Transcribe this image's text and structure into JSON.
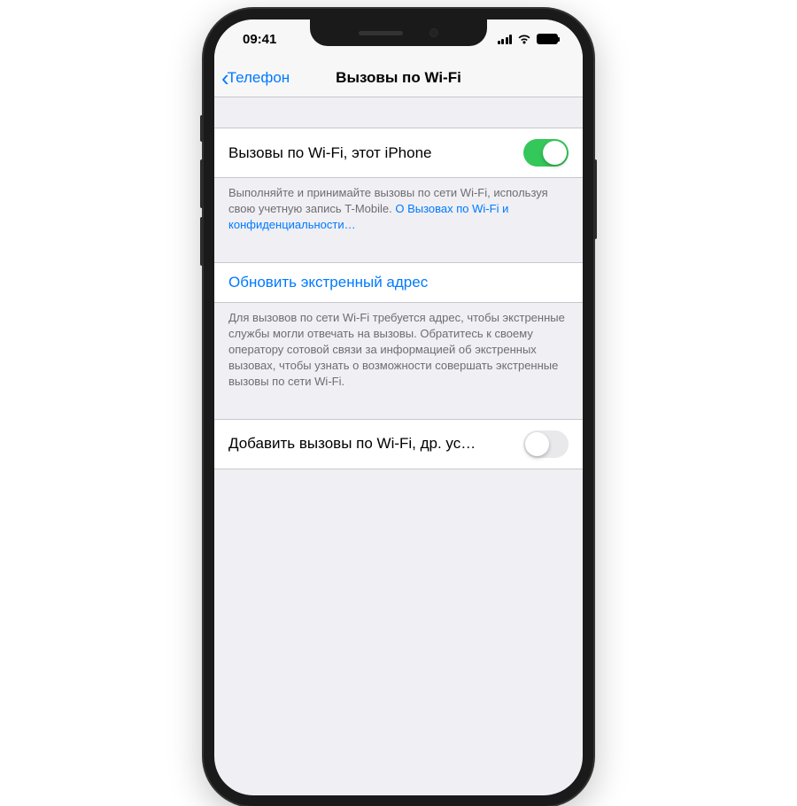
{
  "statusBar": {
    "time": "09:41"
  },
  "nav": {
    "backLabel": "Телефон",
    "title": "Вызовы по Wi-Fi"
  },
  "wifiThisPhone": {
    "label": "Вызовы по Wi-Fi, этот iPhone",
    "enabled": true,
    "footerText": "Выполняйте и принимайте вызовы по сети Wi-Fi, используя свою учетную запись T-Mobile. ",
    "footerLinkText": "О Вызовах по Wi-Fi и конфиденциальности…"
  },
  "emergency": {
    "updateLabel": "Обновить экстренный адрес",
    "footerText": "Для вызовов по сети Wi-Fi требуется адрес, чтобы экстренные службы могли отвечать на вызовы. Обратитесь к своему оператору сотовой связи за информацией об экстренных вызовах, чтобы узнать о возможности совершать экстренные вызовы по сети Wi-Fi."
  },
  "otherDevices": {
    "label": "Добавить вызовы по Wi-Fi, др. ус…",
    "enabled": false
  }
}
